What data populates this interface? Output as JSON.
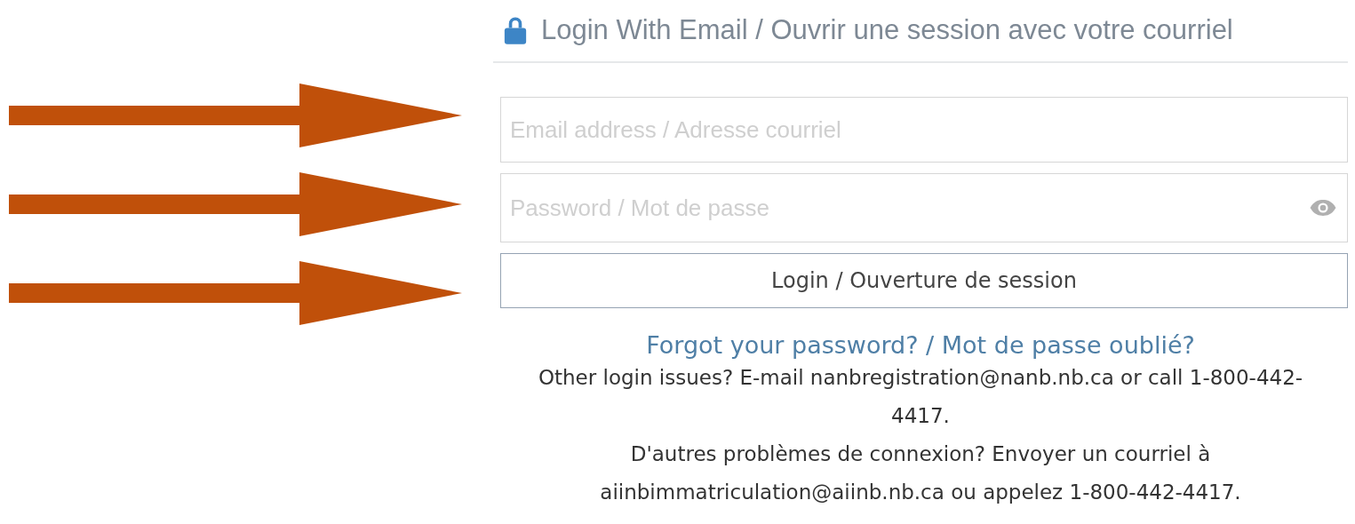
{
  "arrows": [
    {
      "kind": "pointer"
    },
    {
      "kind": "pointer"
    },
    {
      "kind": "pointer"
    }
  ],
  "heading": {
    "title": "Login With Email / Ouvrir une session avec votre courriel"
  },
  "email_field": {
    "placeholder": "Email address / Adresse courriel"
  },
  "password_field": {
    "placeholder": "Password / Mot de passe"
  },
  "login_button": {
    "label": "Login / Ouverture de session"
  },
  "forgot_link": "Forgot your password? / Mot de passe oublié?",
  "help_texts": [
    "Other login issues? E-mail nanbregistration@nanb.nb.ca or call 1-800-442-4417.",
    "D'autres problèmes de connexion? Envoyer un courriel à aiinbimmatriculation@aiinb.nb.ca ou appelez 1-800-442-4417."
  ]
}
